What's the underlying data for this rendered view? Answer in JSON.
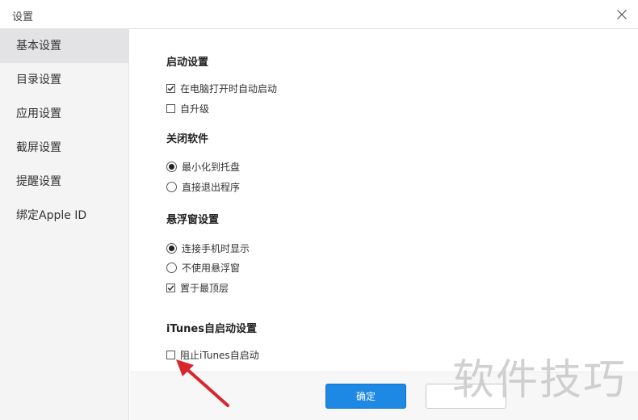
{
  "window": {
    "title": "设置"
  },
  "sidebar": {
    "items": [
      {
        "label": "基本设置",
        "active": true
      },
      {
        "label": "目录设置",
        "active": false
      },
      {
        "label": "应用设置",
        "active": false
      },
      {
        "label": "截屏设置",
        "active": false
      },
      {
        "label": "提醒设置",
        "active": false
      },
      {
        "label": "绑定Apple ID",
        "active": false
      }
    ]
  },
  "sections": {
    "startup": {
      "title": "启动设置",
      "options": [
        {
          "label": "在电脑打开时自动启动",
          "type": "checkbox",
          "checked": true
        },
        {
          "label": "自升级",
          "type": "checkbox",
          "checked": false
        }
      ]
    },
    "close": {
      "title": "关闭软件",
      "options": [
        {
          "label": "最小化到托盘",
          "type": "radio",
          "checked": true
        },
        {
          "label": "直接退出程序",
          "type": "radio",
          "checked": false
        }
      ]
    },
    "floating": {
      "title": "悬浮窗设置",
      "options": [
        {
          "label": "连接手机时显示",
          "type": "radio",
          "checked": true
        },
        {
          "label": "不使用悬浮窗",
          "type": "radio",
          "checked": false
        },
        {
          "label": "置于最顶层",
          "type": "checkbox",
          "checked": true
        }
      ]
    },
    "itunes": {
      "title": "iTunes自启动设置",
      "options": [
        {
          "label": "阻止iTunes自启动",
          "type": "checkbox",
          "checked": false
        }
      ]
    }
  },
  "footer": {
    "ok_label": "确定"
  },
  "watermark": "软件技巧",
  "icons": {
    "close": "close-icon",
    "check": "checkmark-icon",
    "arrow": "red-arrow-annotation"
  },
  "colors": {
    "primary_button": "#1e88e5",
    "sidebar_bg": "#f4f4f5",
    "sidebar_active": "#e3e3e5",
    "annotation_arrow": "#d9262c"
  }
}
